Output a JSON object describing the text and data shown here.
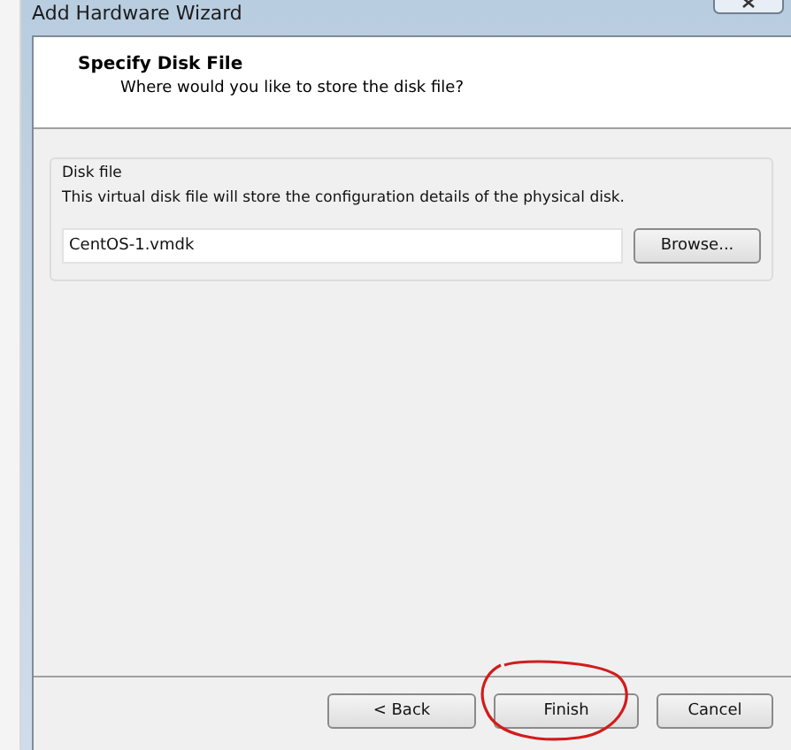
{
  "window": {
    "title": "Add Hardware Wizard"
  },
  "header": {
    "title": "Specify Disk File",
    "subtitle": "Where would you like to store the disk file?"
  },
  "group": {
    "label": "Disk file",
    "description": "This virtual disk file will store the configuration details of the physical disk.",
    "file_field": {
      "value": "CentOS-1.vmdk"
    },
    "browse_button": "Browse..."
  },
  "buttons": [
    {
      "label": "< Back",
      "circled": false
    },
    {
      "label": "Finish",
      "circled": true
    },
    {
      "label": "Cancel",
      "circled": false
    }
  ]
}
